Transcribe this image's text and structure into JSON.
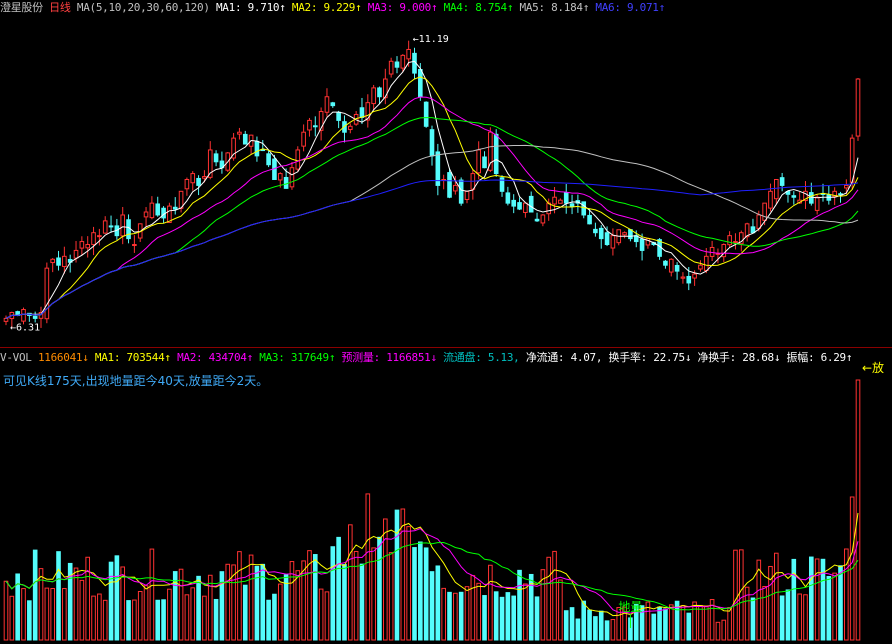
{
  "price_header": {
    "stock_name": "澄星股份",
    "period": "日线",
    "ma_params": "MA(5,10,20,30,60,120)",
    "items": [
      {
        "label": "MA1:",
        "value": "9.710",
        "arrow": "↑",
        "color": "#ffffff"
      },
      {
        "label": "MA2:",
        "value": "9.229",
        "arrow": "↑",
        "color": "#ffff00"
      },
      {
        "label": "MA3:",
        "value": "9.000",
        "arrow": "↑",
        "color": "#ff00ff"
      },
      {
        "label": "MA4:",
        "value": "8.754",
        "arrow": "↑",
        "color": "#00ff00"
      },
      {
        "label": "MA5:",
        "value": "8.184",
        "arrow": "↑",
        "color": "#c0c0c0"
      },
      {
        "label": "MA6:",
        "value": "9.071",
        "arrow": "↑",
        "color": "#4040ff"
      }
    ]
  },
  "volume_header": {
    "name": "V-VOL",
    "items": [
      {
        "label": "",
        "value": "1166041",
        "arrow": "↓",
        "color": "#ff8c00"
      },
      {
        "label": "MA1:",
        "value": "703544",
        "arrow": "↑",
        "color": "#ffff00"
      },
      {
        "label": "MA2:",
        "value": "434704",
        "arrow": "↑",
        "color": "#ff00ff"
      },
      {
        "label": "MA3:",
        "value": "317649",
        "arrow": "↑",
        "color": "#00ff00"
      },
      {
        "label": "预测量:",
        "value": "1166851",
        "arrow": "↓",
        "color": "#ff00ff"
      },
      {
        "label": "流通盘:",
        "value": "5.13",
        "arrow": ",",
        "color": "#00c0c0"
      },
      {
        "label": "净流通:",
        "value": "4.07",
        "arrow": ",",
        "color": "#ffffff"
      },
      {
        "label": "换手率:",
        "value": "22.75",
        "arrow": "↓",
        "color": "#ffffff"
      },
      {
        "label": "净换手:",
        "value": "28.68",
        "arrow": "↓",
        "color": "#ffffff"
      },
      {
        "label": "振幅:",
        "value": "6.29",
        "arrow": "↑",
        "color": "#ffffff"
      }
    ]
  },
  "volume_note": "可见K线175天,出现地量距今40天,放量距今2天。",
  "annotations": {
    "high_label": "11.19",
    "low_label": "6.31",
    "di_liang": "地量",
    "fang_liang": "←放",
    "fang_arrow": "↓"
  },
  "colors": {
    "up": "#ff3232",
    "down": "#54fcfc",
    "ma1": "#ffffff",
    "ma2": "#ffff00",
    "ma3": "#ff00ff",
    "ma4": "#00ff00",
    "ma5": "#c0c0c0",
    "ma6": "#2020ff",
    "vol": "#ff3232",
    "volDown": "#54fcfc"
  },
  "chart_data": {
    "type": "candlestick",
    "title": "澄星股份 日线",
    "price_range": [
      6.0,
      11.6
    ],
    "high": 11.19,
    "low": 6.31,
    "closes": [
      6.45,
      6.55,
      6.5,
      6.6,
      6.5,
      6.45,
      6.55,
      7.3,
      7.45,
      7.35,
      7.5,
      7.4,
      7.6,
      7.75,
      7.7,
      7.9,
      7.85,
      8.1,
      8.0,
      7.85,
      8.2,
      7.8,
      7.7,
      8.05,
      8.25,
      8.4,
      8.2,
      8.15,
      8.35,
      8.3,
      8.6,
      8.8,
      8.9,
      8.7,
      8.85,
      9.3,
      9.1,
      9.0,
      9.25,
      9.5,
      9.6,
      9.4,
      9.55,
      9.2,
      9.3,
      9.05,
      8.8,
      8.9,
      8.65,
      9.0,
      9.3,
      9.6,
      9.8,
      9.7,
      9.95,
      10.2,
      10.05,
      9.8,
      9.6,
      9.7,
      9.9,
      9.85,
      10.1,
      10.35,
      10.2,
      10.5,
      10.8,
      10.7,
      10.9,
      11.0,
      10.6,
      10.2,
      9.7,
      9.2,
      8.7,
      8.8,
      8.5,
      8.7,
      8.4,
      8.6,
      8.9,
      9.3,
      9.0,
      9.6,
      8.9,
      8.6,
      8.4,
      8.35,
      8.3,
      8.4,
      8.25,
      8.1,
      8.2,
      8.4,
      8.5,
      8.45,
      8.4,
      8.35,
      8.4,
      8.2,
      8.05,
      7.9,
      7.8,
      7.7,
      7.85,
      7.95,
      7.9,
      7.8,
      7.75,
      7.6,
      7.8,
      7.7,
      7.5,
      7.35,
      7.45,
      7.25,
      7.15,
      7.05,
      7.2,
      7.35,
      7.5,
      7.65,
      7.55,
      7.7,
      7.85,
      7.75,
      7.9,
      8.05,
      7.9,
      8.2,
      8.4,
      8.6,
      8.8,
      8.7,
      8.55,
      8.5,
      8.45,
      8.6,
      8.4,
      8.5,
      8.55,
      8.45,
      8.6,
      8.55,
      8.7,
      9.5,
      10.5
    ]
  }
}
